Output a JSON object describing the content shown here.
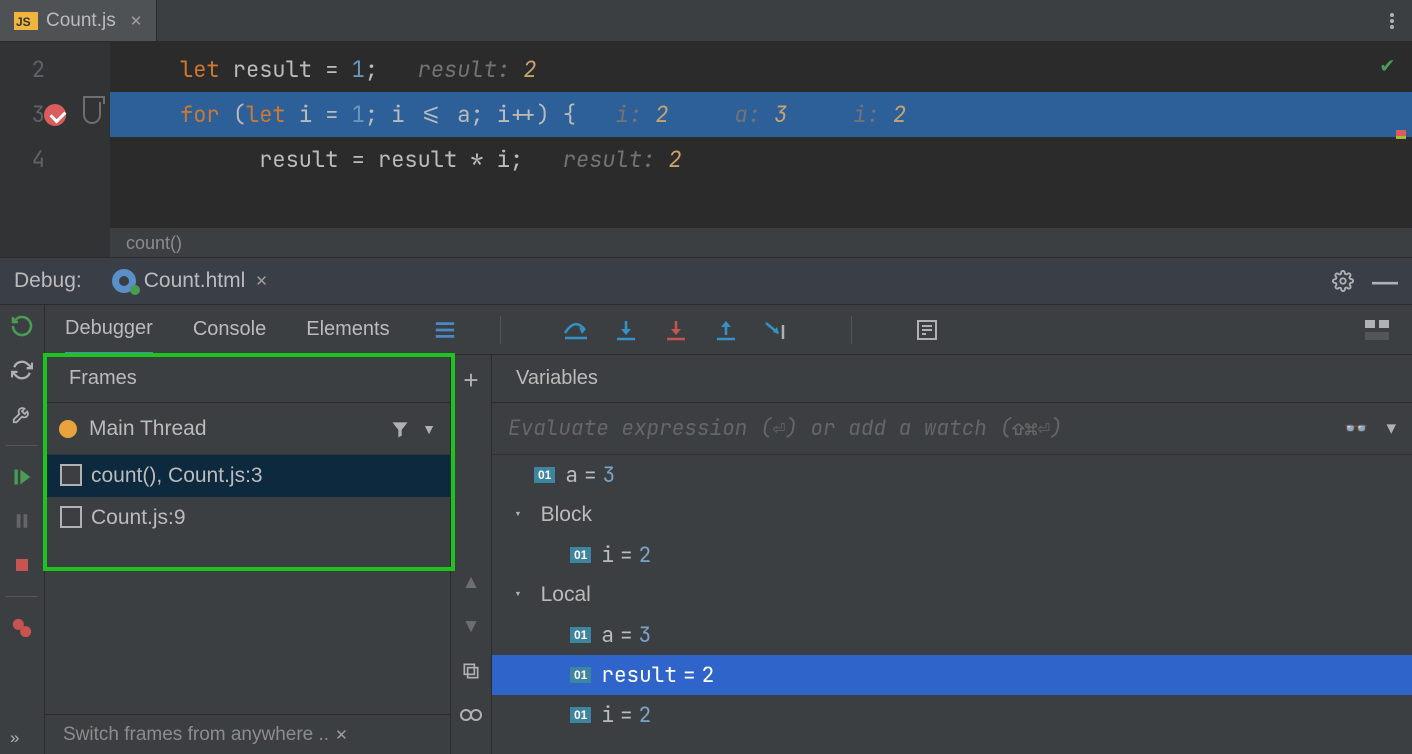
{
  "editor": {
    "tab_filename": "Count.js",
    "lines": [
      {
        "num": "2",
        "text_prefix": "  ",
        "kw1": "let",
        "rest1": " result = ",
        "num1": "1",
        "rest2": ";",
        "hint_label": "   result: ",
        "hint_val": "2"
      },
      {
        "num": "3",
        "text_prefix": "  ",
        "kw1": "for",
        "rest1": " (",
        "kw2": "let",
        "rest2": " i = ",
        "num1": "1",
        "rest3": "; i <= a; i++) {",
        "hints": "   i: 2     a: 3     i: 2"
      },
      {
        "num": "4",
        "text_prefix": "      result = result * i;",
        "hint_label": "   result: ",
        "hint_val": "2"
      }
    ],
    "breadcrumb": "count()"
  },
  "debug_header": {
    "label": "Debug:",
    "run_config": "Count.html"
  },
  "tabs": {
    "debugger": "Debugger",
    "console": "Console",
    "elements": "Elements"
  },
  "frames": {
    "title": "Frames",
    "thread": "Main Thread",
    "items": [
      "count(), Count.js:3",
      "Count.js:9"
    ],
    "footer": "Switch frames from anywhere .."
  },
  "variables": {
    "title": "Variables",
    "watch_placeholder": "Evaluate expression (⏎) or add a watch (⇧⌘⏎)",
    "tree": [
      {
        "indent": 0,
        "badge": "01",
        "name": "a",
        "eq": " = ",
        "val": "3",
        "sel": false
      },
      {
        "indent": 1,
        "chev": "▾",
        "name": "Block"
      },
      {
        "indent": 2,
        "badge": "01",
        "name": "i",
        "eq": " = ",
        "val": "2"
      },
      {
        "indent": 1,
        "chev": "▾",
        "name": "Local"
      },
      {
        "indent": 2,
        "badge": "01",
        "name": "a",
        "eq": " = ",
        "val": "3"
      },
      {
        "indent": 2,
        "badge": "01",
        "name": "result",
        "eq": " = ",
        "val": "2",
        "sel": true
      },
      {
        "indent": 2,
        "badge": "01",
        "name": "i",
        "eq": " = ",
        "val": "2"
      }
    ]
  }
}
